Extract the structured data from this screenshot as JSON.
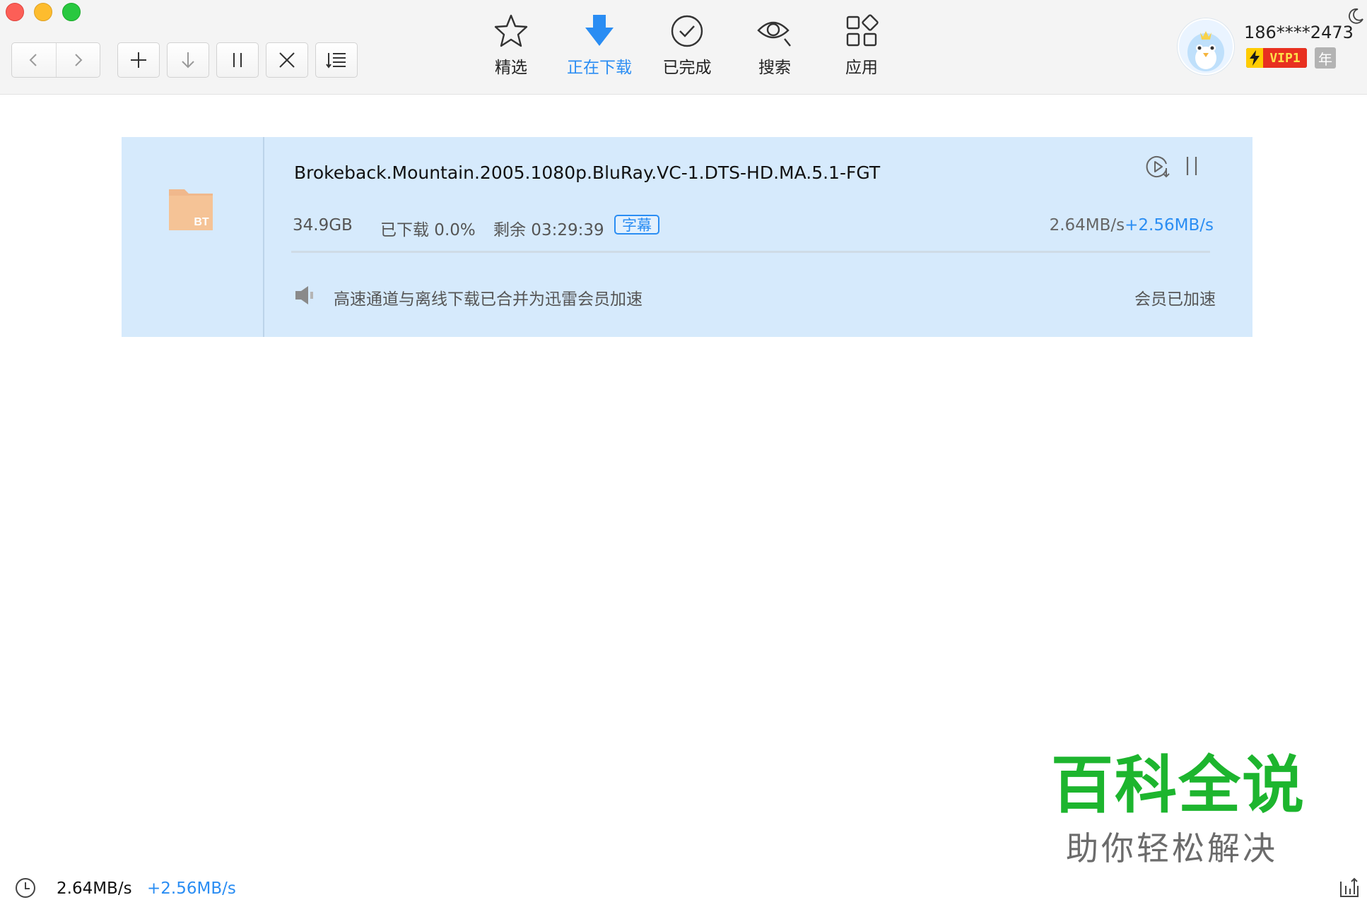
{
  "window": {
    "controls": [
      "close",
      "minimize",
      "zoom"
    ]
  },
  "toolbar": {
    "buttons": [
      {
        "name": "back",
        "icon": "chevron-left-icon"
      },
      {
        "name": "forward",
        "icon": "chevron-right-icon"
      },
      {
        "name": "new-task",
        "icon": "plus-icon"
      },
      {
        "name": "start",
        "icon": "download-arrow-icon"
      },
      {
        "name": "pause",
        "icon": "pause-icon"
      },
      {
        "name": "delete",
        "icon": "close-icon"
      },
      {
        "name": "sort",
        "icon": "list-sort-icon"
      }
    ],
    "tabs": [
      {
        "label": "精选",
        "icon": "star-icon",
        "active": false
      },
      {
        "label": "正在下载",
        "icon": "download-arrow-icon",
        "active": true
      },
      {
        "label": "已完成",
        "icon": "check-circle-icon",
        "active": false
      },
      {
        "label": "搜索",
        "icon": "eye-search-icon",
        "active": false
      },
      {
        "label": "应用",
        "icon": "apps-grid-icon",
        "active": false
      }
    ],
    "user": {
      "name": "186****2473",
      "vip_label": "VIP1",
      "year_label": "年"
    }
  },
  "task": {
    "name": "Brokeback.Mountain.2005.1080p.BluRay.VC-1.DTS-HD.MA.5.1-FGT",
    "type_label": "BT",
    "size": "34.9GB",
    "downloaded": "已下载 0.0%",
    "remaining": "剩余 03:29:39",
    "subtitle_tag": "字幕",
    "speed": "2.64MB/s",
    "speed_boost": "+2.56MB/s",
    "progress": 0.0,
    "notice": "高速通道与离线下载已合并为迅雷会员加速",
    "accel_status": "会员已加速"
  },
  "status_bar": {
    "speed": "2.64MB/s",
    "speed_boost": "+2.56MB/s"
  },
  "watermark": {
    "main": "百科全说",
    "sub": "助你轻松解决"
  },
  "colors": {
    "accent": "#2a8df3",
    "card_bg": "#d6eafc",
    "toolbar_bg": "#f4f4f4",
    "watermark_green": "#1db52e"
  }
}
